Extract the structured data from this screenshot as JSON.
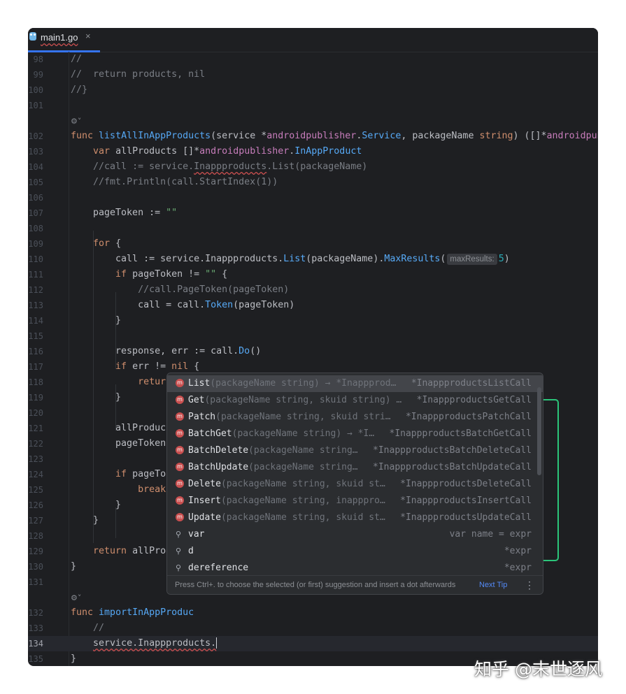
{
  "tab": {
    "name": "main1.go",
    "close": "×",
    "icon": "gopher-icon"
  },
  "lines": [
    {
      "n": "98",
      "code": "<span class='c'>//</span>"
    },
    {
      "n": "99",
      "code": "<span class='c'>//  return products, nil</span>"
    },
    {
      "n": "100",
      "code": "<span class='c'>//}</span>"
    },
    {
      "n": "101",
      "code": ""
    },
    {
      "n": "",
      "hint": "⚙˅"
    },
    {
      "n": "102",
      "code": "<span class='k'>func</span> <span class='f'>listAllInAppProducts</span>(service *<span class='t'>androidpublisher</span>.<span class='m'>Service</span>, packageName <span class='k'>string</span>) ([]*<span class='t'>androidpublisher</span>"
    },
    {
      "n": "103",
      "code": "    <span class='k'>var</span> allProducts []*<span class='t'>androidpublisher</span>.<span class='m'>InAppProduct</span>"
    },
    {
      "n": "104",
      "code": "    <span class='c'>//call := service.<span class='squig'>Inappproducts</span>.List(packageName)</span>"
    },
    {
      "n": "105",
      "code": "    <span class='c'>//fmt.Println(call.StartIndex(1))</span>"
    },
    {
      "n": "106",
      "code": ""
    },
    {
      "n": "107",
      "code": "    pageToken := <span class='s'>\"\"</span>"
    },
    {
      "n": "108",
      "code": ""
    },
    {
      "n": "109",
      "code": "    <span class='k'>for</span> {"
    },
    {
      "n": "110",
      "code": "        call := service.Inappproducts.<span class='m'>List</span>(packageName).<span class='m'>MaxResults</span>(<span class='inl'>maxResults:</span><span class='n'>5</span>)"
    },
    {
      "n": "111",
      "code": "        <span class='k'>if</span> pageToken != <span class='s'>\"\"</span> {"
    },
    {
      "n": "112",
      "code": "            <span class='c'>//call.PageToken(pageToken)</span>"
    },
    {
      "n": "113",
      "code": "            call = call.<span class='m'>Token</span>(pageToken)"
    },
    {
      "n": "114",
      "code": "        }"
    },
    {
      "n": "115",
      "code": ""
    },
    {
      "n": "116",
      "code": "        response, err := call.<span class='m'>Do</span>()"
    },
    {
      "n": "117",
      "code": "        <span class='k'>if</span> err != <span class='k'>nil</span> {"
    },
    {
      "n": "118",
      "code": "            <span class='k'>return</span> <span class='k'>nil</span>, fmt.<span class='m'>Errorf</span>(<span class='inl'>format:</span><span class='s'>\"获取商品列表失败: %v\"</span>, err)"
    },
    {
      "n": "119",
      "code": "        }"
    },
    {
      "n": "120",
      "code": ""
    },
    {
      "n": "121",
      "code": "        allProducts = "
    },
    {
      "n": "122",
      "code": "        pageToken = re"
    },
    {
      "n": "123",
      "code": ""
    },
    {
      "n": "124",
      "code": "        <span class='k'>if</span> pageToken ="
    },
    {
      "n": "125",
      "code": "            <span class='k'>break</span>"
    },
    {
      "n": "126",
      "code": "        }"
    },
    {
      "n": "127",
      "code": "    }"
    },
    {
      "n": "128",
      "code": ""
    },
    {
      "n": "129",
      "code": "    <span class='k'>return</span> allProducts"
    },
    {
      "n": "130",
      "code": "}"
    },
    {
      "n": "131",
      "code": ""
    },
    {
      "n": "",
      "hint": "⚙˅"
    },
    {
      "n": "132",
      "code": "<span class='k'>func</span> <span class='f'>importInAppProduc</span>"
    },
    {
      "n": "133",
      "code": "    <span class='c'>//</span>"
    },
    {
      "n": "134",
      "code": "    <span class='squig'>service.Inappproducts.</span><span class='caret'></span>",
      "cur": true
    },
    {
      "n": "135",
      "code": "}"
    },
    {
      "n": "136",
      "code": ""
    }
  ],
  "completion": {
    "items": [
      {
        "name": "List",
        "sig": "(packageName string) → *Inappprod…",
        "type": "*InappproductsListCall",
        "icon": "method-icon",
        "mark": "m",
        "selected": true
      },
      {
        "name": "Get",
        "sig": "(packageName string, skuid string) …",
        "type": "*InappproductsGetCall",
        "icon": "method-icon",
        "mark": "m"
      },
      {
        "name": "Patch",
        "sig": "(packageName string, skuid stri…",
        "type": "*InappproductsPatchCall",
        "icon": "method-icon",
        "mark": "m"
      },
      {
        "name": "BatchGet",
        "sig": "(packageName string) → *I…",
        "type": "*InappproductsBatchGetCall",
        "icon": "method-icon",
        "mark": "m"
      },
      {
        "name": "BatchDelete",
        "sig": "(packageName string…",
        "type": "*InappproductsBatchDeleteCall",
        "icon": "method-icon",
        "mark": "m"
      },
      {
        "name": "BatchUpdate",
        "sig": "(packageName string…",
        "type": "*InappproductsBatchUpdateCall",
        "icon": "method-icon",
        "mark": "m"
      },
      {
        "name": "Delete",
        "sig": "(packageName string, skuid st…",
        "type": "*InappproductsDeleteCall",
        "icon": "method-icon",
        "mark": "m"
      },
      {
        "name": "Insert",
        "sig": "(packageName string, inapppro…",
        "type": "*InappproductsInsertCall",
        "icon": "method-icon",
        "mark": "m"
      },
      {
        "name": "Update",
        "sig": "(packageName string, skuid st…",
        "type": "*InappproductsUpdateCall",
        "icon": "method-icon",
        "mark": "m"
      },
      {
        "name": "var",
        "sig": "",
        "type": "var name = expr",
        "icon": "template-icon",
        "mark": "⚲"
      },
      {
        "name": "d",
        "sig": "",
        "type": "*expr",
        "icon": "template-icon",
        "mark": "⚲"
      },
      {
        "name": "dereference",
        "sig": "",
        "type": "*expr",
        "icon": "template-icon",
        "mark": "⚲"
      }
    ],
    "footer": "Press Ctrl+. to choose the selected (or first) suggestion and insert a dot afterwards",
    "next_tip": "Next Tip",
    "menu": "⋮"
  },
  "watermark": "知乎 @末世逐风"
}
